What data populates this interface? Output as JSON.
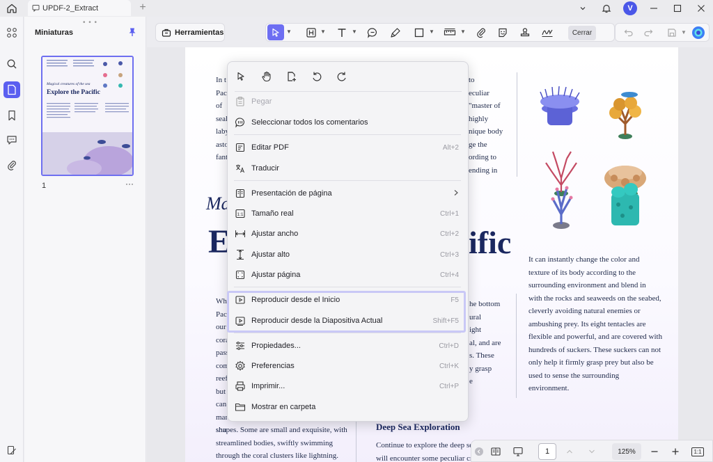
{
  "app": {
    "tab_title": "UPDF-2_Extract",
    "avatar_letter": "V",
    "accent_color": "#5b5ff0"
  },
  "thumbnails": {
    "title": "Miniaturas",
    "page_label": "1",
    "more": "···"
  },
  "thumb_content": {
    "subtitle": "Magical creatures of the sea",
    "title": "Explore the Pacific"
  },
  "toolbar": {
    "tools_label": "Herramientas",
    "close_label": "Cerrar"
  },
  "document": {
    "top_left_lines": [
      "In t",
      "Pac",
      "of",
      "seal",
      "laby",
      "asto",
      "fant"
    ],
    "top_right_lines": [
      "to",
      "eculiar",
      "\"master of",
      "highly",
      "nique body",
      "ge the",
      "ording to",
      "ending in"
    ],
    "subtitle_fragment": "Ma",
    "title_left_fragment": "E",
    "title_right_fragment": "ific",
    "mid_left_lines": [
      "Wh",
      "Pac",
      "our",
      "cora",
      "pass",
      "com",
      "reef",
      "but",
      "can",
      "mar",
      "shu"
    ],
    "mid_center_lines": [
      "he bottom",
      "ural",
      "ight",
      "al, and are",
      "s. These",
      "y grasp",
      "e"
    ],
    "right_paragraph": [
      "It can instantly change the color and",
      "texture of its body according to the",
      "surrounding environment and blend in",
      "with the rocks and seaweeds on the seabed,",
      "cleverly avoiding natural enemies or",
      "ambushing prey. Its eight tentacles are",
      "flexible and powerful, and are covered with",
      "hundreds of suckers. These suckers can not",
      "only help it firmly grasp prey but also be",
      "used to sense the surrounding",
      "environment."
    ],
    "bottom_left_lines": [
      "shapes. Some are small and exquisite, with",
      "streamlined bodies, swiftly swimming",
      "through the coral clusters like lightning."
    ],
    "section_heading": "Deep Sea Exploration",
    "section_lines": [
      "Continue to explore the deep sea,",
      "will encounter some peculiar cre"
    ]
  },
  "context_menu": {
    "items": [
      {
        "label": "Pegar",
        "shortcut": "",
        "icon": "paste-icon",
        "disabled": true
      },
      {
        "label": "Seleccionar todos los comentarios",
        "shortcut": "",
        "icon": "comment-select-icon"
      },
      {
        "label": "Editar PDF",
        "shortcut": "Alt+2",
        "icon": "edit-pdf-icon"
      },
      {
        "label": "Traducir",
        "shortcut": "",
        "icon": "translate-icon"
      },
      {
        "label": "Presentación de página",
        "shortcut": "",
        "icon": "page-layout-icon",
        "submenu": true
      },
      {
        "label": "Tamaño real",
        "shortcut": "Ctrl+1",
        "icon": "actual-size-icon"
      },
      {
        "label": "Ajustar ancho",
        "shortcut": "Ctrl+2",
        "icon": "fit-width-icon"
      },
      {
        "label": "Ajustar alto",
        "shortcut": "Ctrl+3",
        "icon": "fit-height-icon"
      },
      {
        "label": "Ajustar página",
        "shortcut": "Ctrl+4",
        "icon": "fit-page-icon"
      },
      {
        "label": "Reproducir desde el Inicio",
        "shortcut": "F5",
        "icon": "play-start-icon"
      },
      {
        "label": "Reproducir desde la Diapositiva Actual",
        "shortcut": "Shift+F5",
        "icon": "play-current-icon"
      },
      {
        "label": "Propiedades...",
        "shortcut": "Ctrl+D",
        "icon": "properties-icon"
      },
      {
        "label": "Preferencias",
        "shortcut": "Ctrl+K",
        "icon": "preferences-icon"
      },
      {
        "label": "Imprimir...",
        "shortcut": "Ctrl+P",
        "icon": "print-icon"
      },
      {
        "label": "Mostrar en carpeta",
        "shortcut": "",
        "icon": "folder-icon"
      }
    ]
  },
  "bottom_bar": {
    "page": "1",
    "zoom": "125%",
    "fit_label": "1:1"
  }
}
